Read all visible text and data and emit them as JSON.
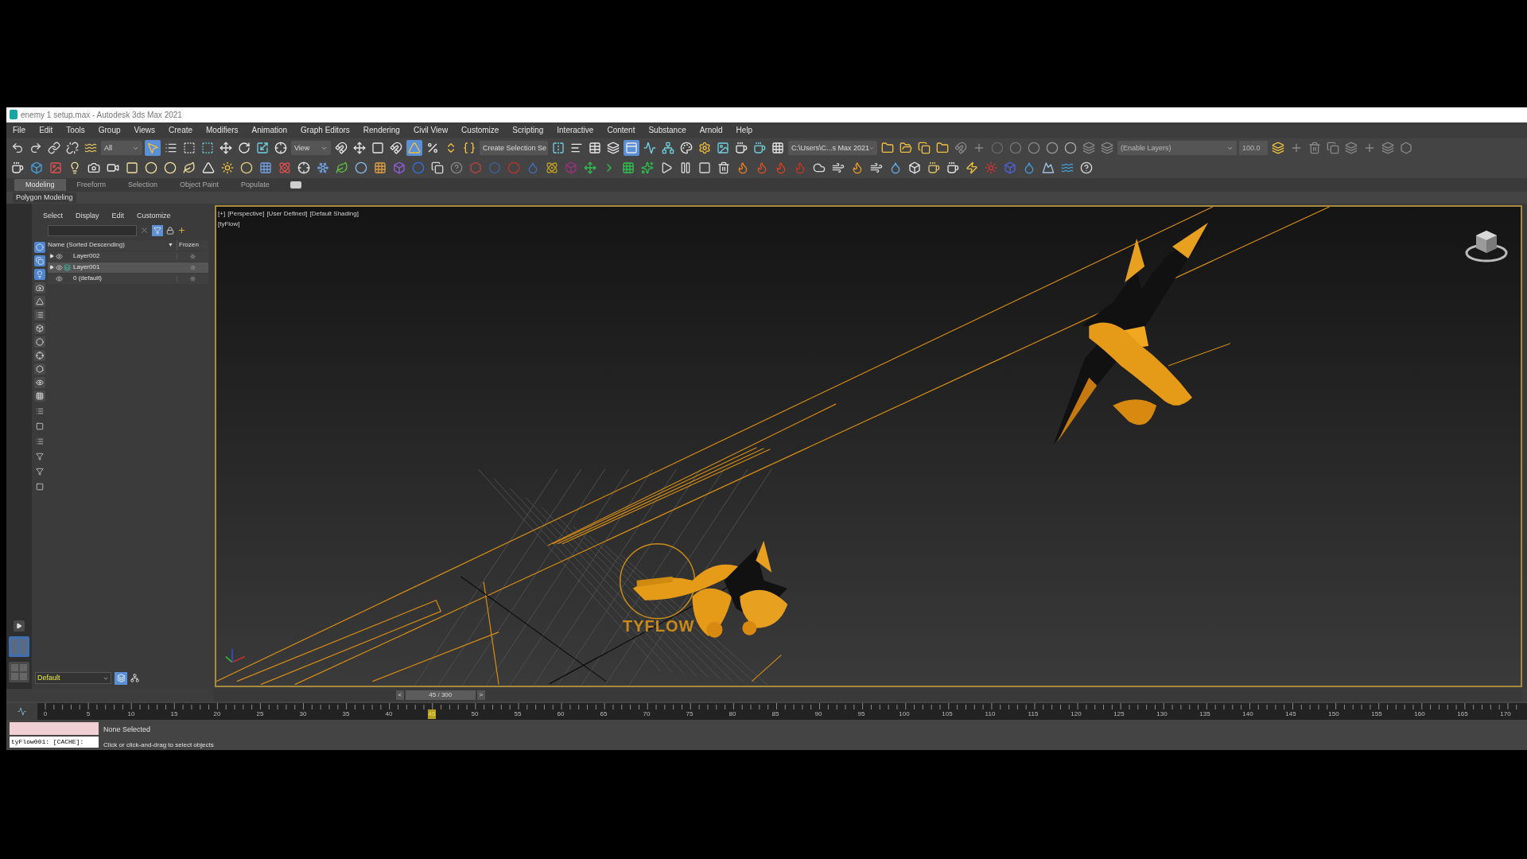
{
  "window": {
    "title": "enemy 1 setup.max - Autodesk 3ds Max 2021"
  },
  "menu_bar": [
    "File",
    "Edit",
    "Tools",
    "Group",
    "Views",
    "Create",
    "Modifiers",
    "Animation",
    "Graph Editors",
    "Rendering",
    "Civil View",
    "Customize",
    "Scripting",
    "Interactive",
    "Content",
    "Substance",
    "Arnold",
    "Help"
  ],
  "toolbar": {
    "selection_filter": "All",
    "reference_coordinate": "View",
    "named_selection": "Create Selection Se",
    "project_path": "C:\\Users\\C...s Max 2021",
    "layer_field": "(Enable Layers)",
    "layer_value": "100.0"
  },
  "ribbon": {
    "tabs": [
      {
        "label": "Modeling",
        "selected": true
      },
      {
        "label": "Freeform",
        "selected": false
      },
      {
        "label": "Selection",
        "selected": false
      },
      {
        "label": "Object Paint",
        "selected": false
      },
      {
        "label": "Populate",
        "selected": false
      }
    ],
    "panel_label": "Polygon Modeling"
  },
  "scene_explorer": {
    "menus": [
      "Select",
      "Display",
      "Edit",
      "Customize"
    ],
    "columns": [
      "Name (Sorted Descending)",
      "Frozen"
    ],
    "sort_indicator": "▼",
    "rows": [
      {
        "name": "Layer002",
        "expandable": true,
        "selected": false,
        "active": false
      },
      {
        "name": "Layer001",
        "expandable": true,
        "selected": true,
        "active": true
      },
      {
        "name": "0 (default)",
        "expandable": false,
        "selected": false,
        "active": false
      }
    ],
    "layer_dropdown": "Default"
  },
  "viewport": {
    "labels": [
      "[+]",
      "[Perspective]",
      "[User Defined]",
      "[Default Shading]"
    ],
    "sublabel": "[tyFlow]",
    "logo_text": "TYFLOW"
  },
  "time_slider": {
    "prev": "<",
    "reading": "45 / 300",
    "next": ">",
    "level": 0.15
  },
  "timeline": {
    "ticks": [
      {
        "label": "0",
        "selected": false
      },
      {
        "label": "5",
        "selected": false
      },
      {
        "label": "10",
        "selected": false
      },
      {
        "label": "15",
        "selected": false
      },
      {
        "label": "20",
        "selected": false
      },
      {
        "label": "25",
        "selected": false
      },
      {
        "label": "30",
        "selected": false
      },
      {
        "label": "35",
        "selected": false
      },
      {
        "label": "40",
        "selected": false
      },
      {
        "label": "45",
        "selected": true
      },
      {
        "label": "50",
        "selected": false
      },
      {
        "label": "55",
        "selected": false
      },
      {
        "label": "60",
        "selected": false
      },
      {
        "label": "65",
        "selected": false
      },
      {
        "label": "70",
        "selected": false
      },
      {
        "label": "75",
        "selected": false
      },
      {
        "label": "80",
        "selected": false
      },
      {
        "label": "85",
        "selected": false
      },
      {
        "label": "90",
        "selected": false
      },
      {
        "label": "95",
        "selected": false
      },
      {
        "label": "100",
        "selected": false
      },
      {
        "label": "105",
        "selected": false
      },
      {
        "label": "110",
        "selected": false
      },
      {
        "label": "115",
        "selected": false
      },
      {
        "label": "120",
        "selected": false
      },
      {
        "label": "125",
        "selected": false
      },
      {
        "label": "130",
        "selected": false
      },
      {
        "label": "135",
        "selected": false
      },
      {
        "label": "140",
        "selected": false
      },
      {
        "label": "145",
        "selected": false
      },
      {
        "label": "150",
        "selected": false
      },
      {
        "label": "155",
        "selected": false
      },
      {
        "label": "160",
        "selected": false
      },
      {
        "label": "165",
        "selected": false
      },
      {
        "label": "170",
        "selected": false
      }
    ]
  },
  "status": {
    "selection": "None Selected",
    "prompt": "Click or click-and-drag to select objects",
    "listener": "tyFlow001: [CACHE]:"
  }
}
